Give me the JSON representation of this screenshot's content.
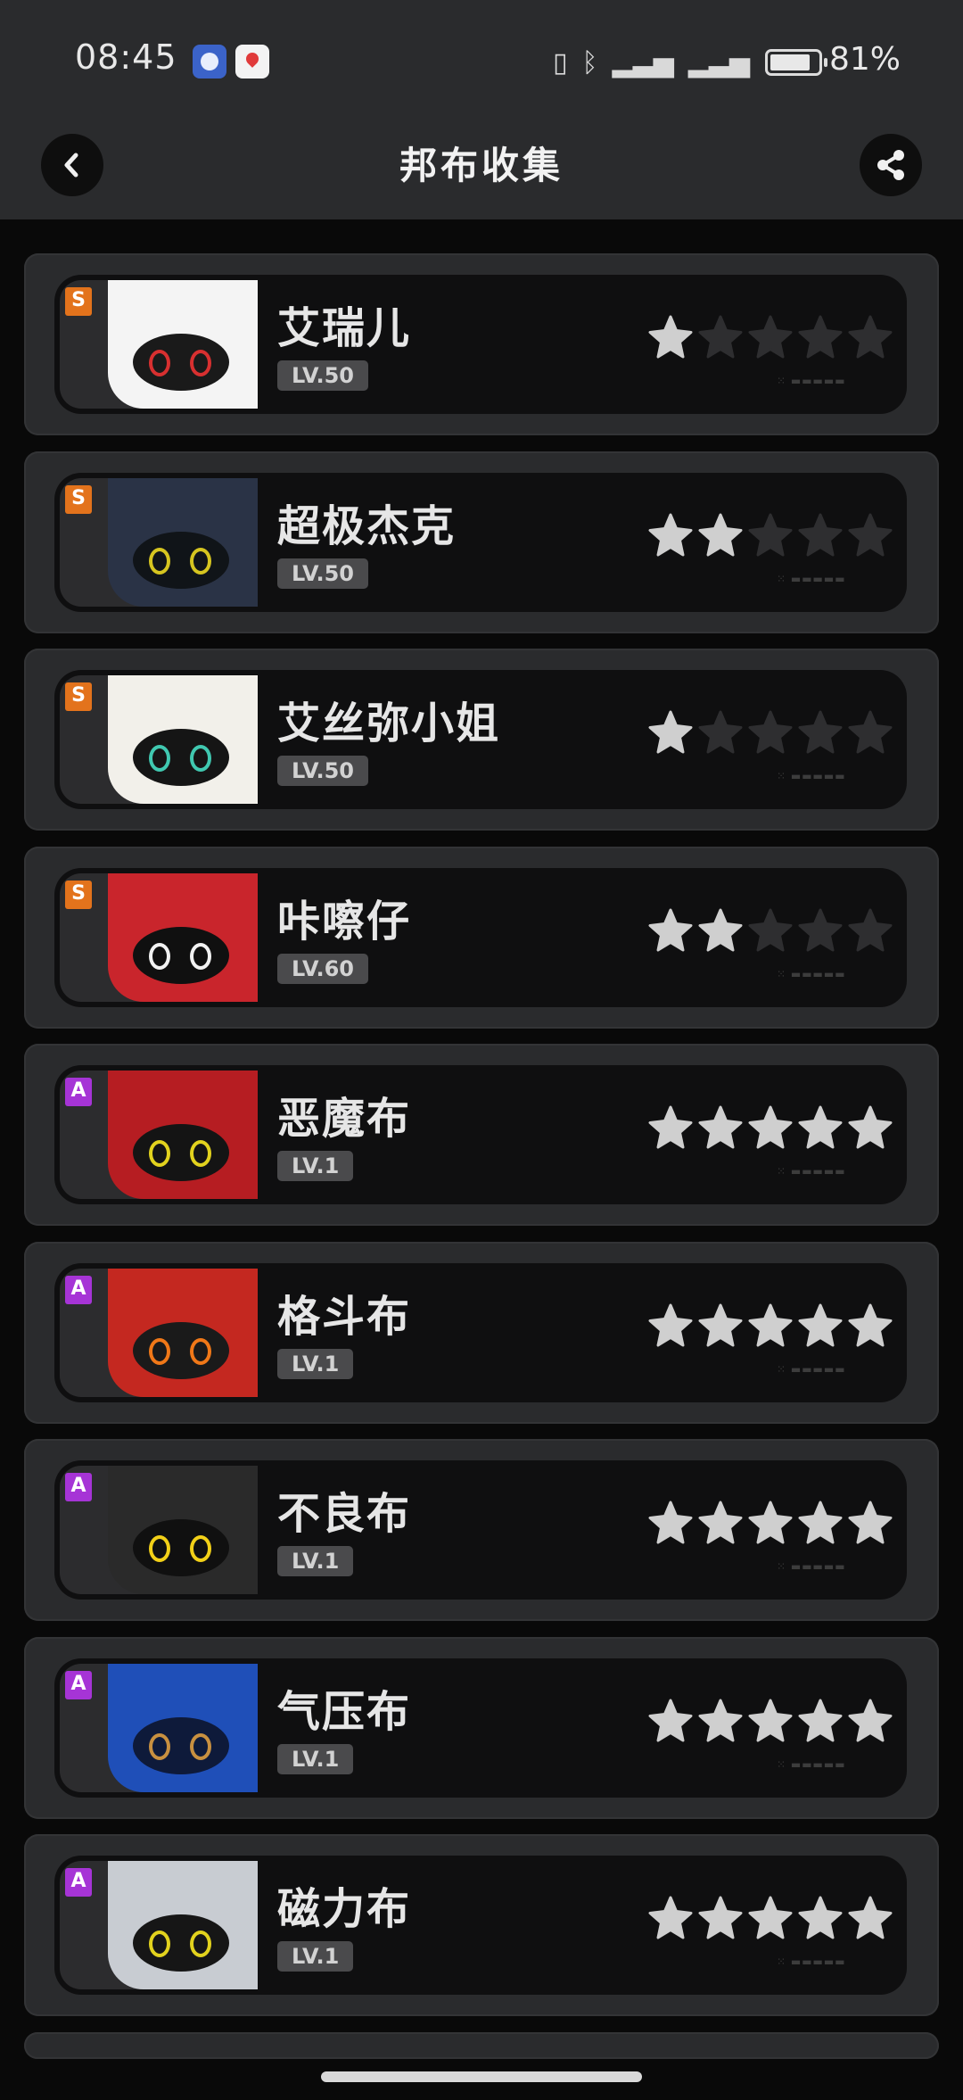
{
  "status": {
    "time": "08:45",
    "battery": "81%",
    "signal": "5G"
  },
  "header": {
    "title": "邦布收集"
  },
  "bangboos": [
    {
      "grade": "S",
      "name": "艾瑞儿",
      "level": "LV.50",
      "stars": 1,
      "art": "#f4f4f4",
      "eye": "#d83030",
      "face": "#1a1a1a"
    },
    {
      "grade": "S",
      "name": "超极杰克",
      "level": "LV.50",
      "stars": 2,
      "art": "#2a3346",
      "eye": "#d6c520",
      "face": "#101418"
    },
    {
      "grade": "S",
      "name": "艾丝弥小姐",
      "level": "LV.50",
      "stars": 1,
      "art": "#f2f0ea",
      "eye": "#40c8b0",
      "face": "#151515"
    },
    {
      "grade": "S",
      "name": "咔嚓仔",
      "level": "LV.60",
      "stars": 2,
      "art": "#c9252c",
      "eye": "#f2f2f2",
      "face": "#101010"
    },
    {
      "grade": "A",
      "name": "恶魔布",
      "level": "LV.1",
      "stars": 5,
      "art": "#b61d22",
      "eye": "#e2d21e",
      "face": "#141414"
    },
    {
      "grade": "A",
      "name": "格斗布",
      "level": "LV.1",
      "stars": 5,
      "art": "#c42820",
      "eye": "#f07818",
      "face": "#1a1a1a"
    },
    {
      "grade": "A",
      "name": "不良布",
      "level": "LV.1",
      "stars": 5,
      "art": "#2a2a2a",
      "eye": "#f2d018",
      "face": "#101010"
    },
    {
      "grade": "A",
      "name": "气压布",
      "level": "LV.1",
      "stars": 5,
      "art": "#1f4fb8",
      "eye": "#c89040",
      "face": "#0e1a3a"
    },
    {
      "grade": "A",
      "name": "磁力布",
      "level": "LV.1",
      "stars": 5,
      "art": "#c8ccd2",
      "eye": "#e2d21e",
      "face": "#161616"
    }
  ],
  "colors": {
    "star_on": "#cfcfcf",
    "star_off": "#2e2e30",
    "grade_S": "#e3731c",
    "grade_A": "#a634d6"
  }
}
